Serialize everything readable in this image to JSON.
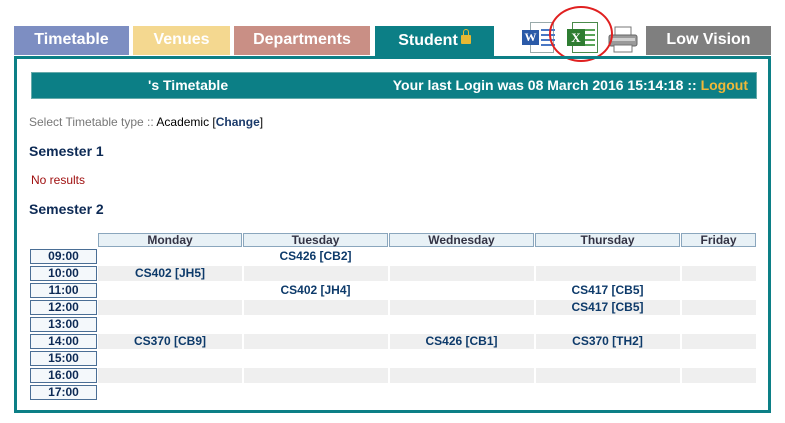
{
  "tabs": {
    "timetable": "Timetable",
    "venues": "Venues",
    "departments": "Departments",
    "student": "Student",
    "low_vision": "Low Vision"
  },
  "toolbar": {
    "word_icon": "word-icon",
    "word_letter": "W",
    "excel_icon": "excel-icon",
    "excel_letter": "X",
    "print_icon": "print-icon"
  },
  "header": {
    "title": "'s Timetable",
    "login_text": "Your last Login was 08 March 2016 15:14:18 ::",
    "logout": "Logout"
  },
  "timetable_type": {
    "label": "Select Timetable type :: ",
    "value": "Academic",
    "change_link": "Change"
  },
  "semester1": {
    "title": "Semester 1",
    "no_results": "No results"
  },
  "semester2": {
    "title": "Semester 2",
    "days": [
      "Monday",
      "Tuesday",
      "Wednesday",
      "Thursday",
      "Friday"
    ],
    "times": [
      "09:00",
      "10:00",
      "11:00",
      "12:00",
      "13:00",
      "14:00",
      "15:00",
      "16:00",
      "17:00"
    ],
    "rows": [
      [
        "",
        "CS426 [CB2]",
        "",
        "",
        ""
      ],
      [
        "CS402 [JH5]",
        "",
        "",
        "",
        ""
      ],
      [
        "",
        "CS402 [JH4]",
        "",
        "CS417 [CB5]",
        ""
      ],
      [
        "",
        "",
        "",
        "CS417 [CB5]",
        ""
      ],
      [
        "",
        "",
        "",
        "",
        ""
      ],
      [
        "CS370 [CB9]",
        "",
        "CS426 [CB1]",
        "CS370 [TH2]",
        ""
      ],
      [
        "",
        "",
        "",
        "",
        ""
      ],
      [
        "",
        "",
        "",
        "",
        ""
      ],
      [
        "",
        "",
        "",
        "",
        ""
      ]
    ]
  },
  "colors": {
    "accent": "#0c7f86",
    "logout": "#f0b838",
    "tab_timetable": "#7d8ec2",
    "tab_venues": "#f4d890",
    "tab_departments": "#c98f85",
    "tab_lowvision": "#7f7f7f",
    "highlight_circle": "#e02020"
  }
}
